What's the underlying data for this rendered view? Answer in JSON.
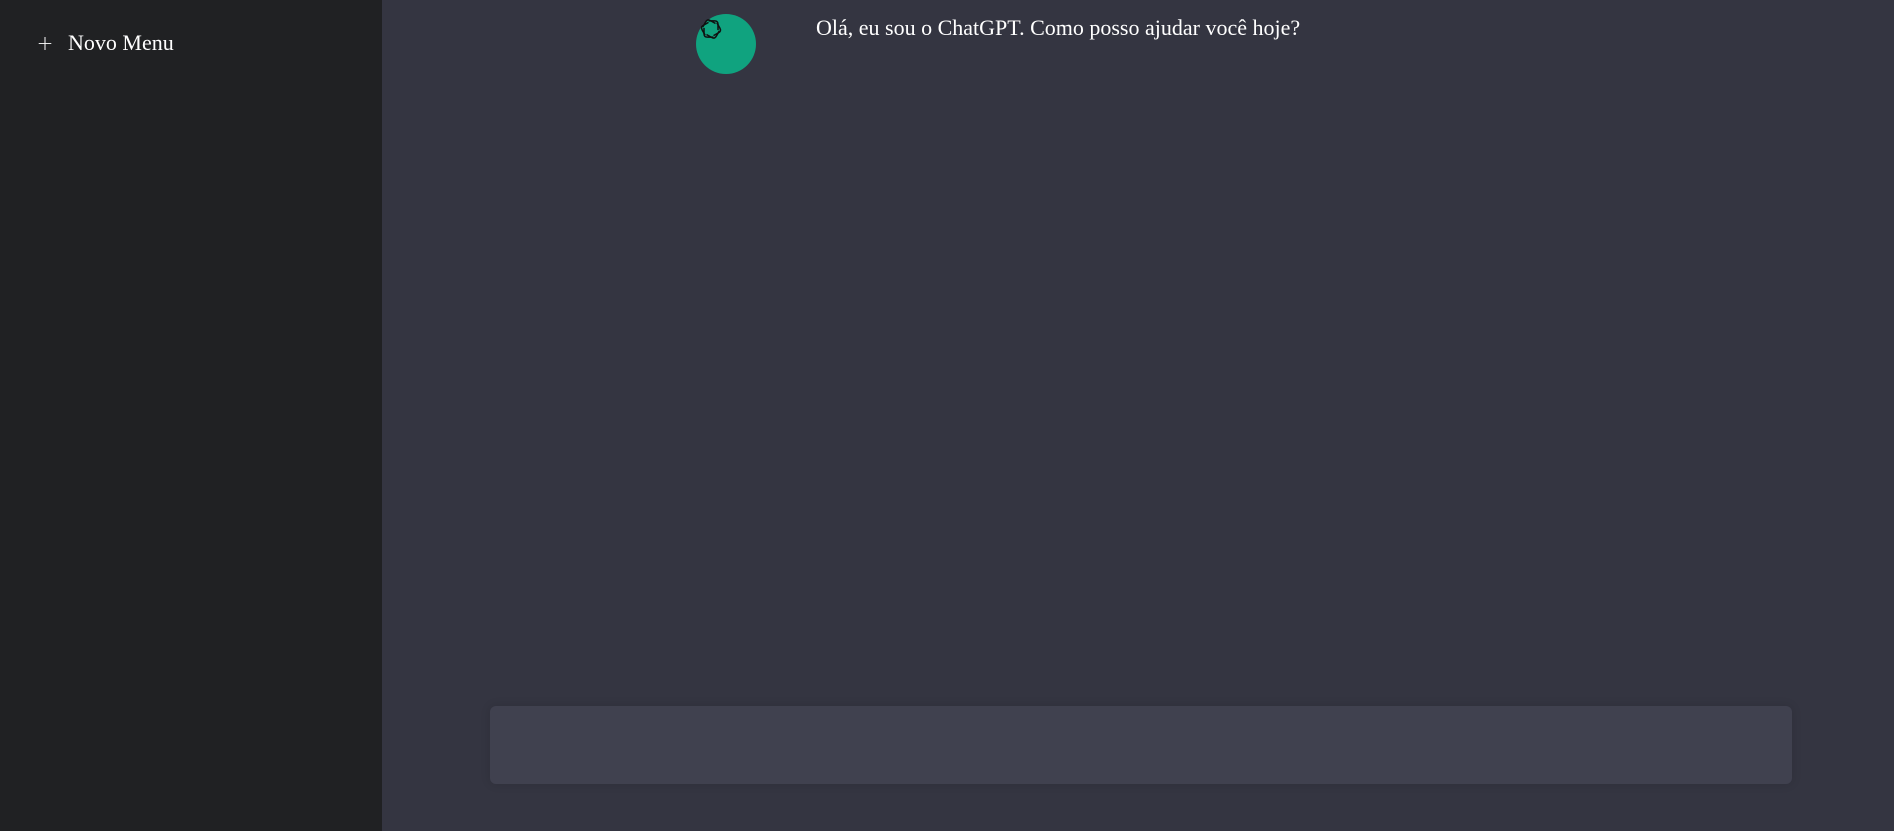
{
  "sidebar": {
    "new_menu": {
      "icon": "plus-icon",
      "label": "Novo Menu"
    }
  },
  "chat": {
    "messages": [
      {
        "avatar_icon": "openai-logo-icon",
        "text": "Olá, eu sou o ChatGPT. Como posso ajudar você hoje?"
      }
    ],
    "input": {
      "value": "",
      "placeholder": ""
    }
  },
  "colors": {
    "sidebar_bg": "#202123",
    "main_bg": "#343541",
    "avatar_bg": "#10a37f",
    "input_bg": "#40414f",
    "text": "#ffffff"
  }
}
